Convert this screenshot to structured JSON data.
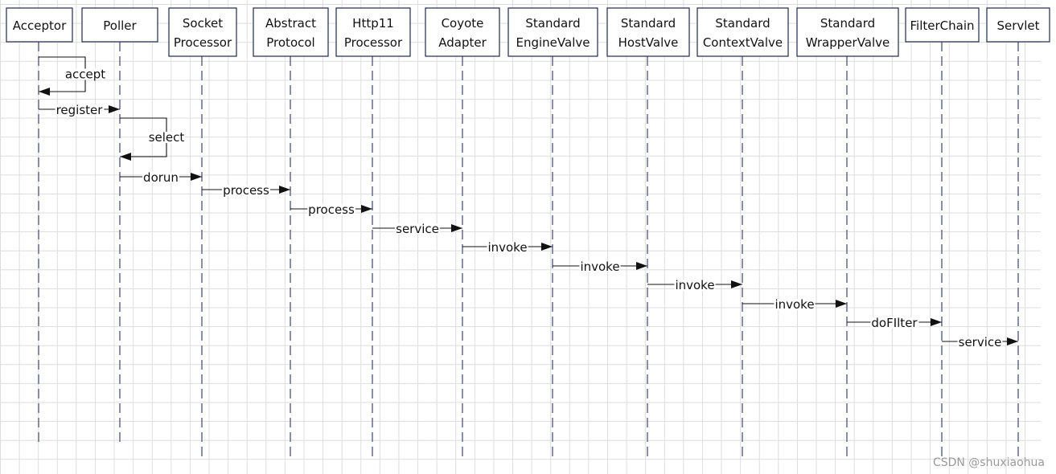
{
  "participants": [
    {
      "id": "acceptor",
      "lines": [
        "Acceptor"
      ]
    },
    {
      "id": "poller",
      "lines": [
        "Poller"
      ]
    },
    {
      "id": "socket-processor",
      "lines": [
        "Socket",
        "Processor"
      ]
    },
    {
      "id": "abstract-protocol",
      "lines": [
        "Abstract",
        "Protocol"
      ]
    },
    {
      "id": "http11-processor",
      "lines": [
        "Http11",
        "Processor"
      ]
    },
    {
      "id": "coyote-adapter",
      "lines": [
        "Coyote",
        "Adapter"
      ]
    },
    {
      "id": "standard-engine-valve",
      "lines": [
        "Standard",
        "EngineValve"
      ]
    },
    {
      "id": "standard-host-valve",
      "lines": [
        "Standard",
        "HostValve"
      ]
    },
    {
      "id": "standard-context-valve",
      "lines": [
        "Standard",
        "ContextValve"
      ]
    },
    {
      "id": "standard-wrapper-valve",
      "lines": [
        "Standard",
        "WrapperValve"
      ]
    },
    {
      "id": "filter-chain",
      "lines": [
        "FilterChain"
      ]
    },
    {
      "id": "servlet",
      "lines": [
        "Servlet"
      ]
    }
  ],
  "messages": [
    {
      "from": 0,
      "to": 0,
      "label": "accept"
    },
    {
      "from": 0,
      "to": 1,
      "label": "register"
    },
    {
      "from": 1,
      "to": 1,
      "label": "select"
    },
    {
      "from": 1,
      "to": 2,
      "label": "dorun"
    },
    {
      "from": 2,
      "to": 3,
      "label": "process"
    },
    {
      "from": 3,
      "to": 4,
      "label": "process"
    },
    {
      "from": 4,
      "to": 5,
      "label": "service"
    },
    {
      "from": 5,
      "to": 6,
      "label": "invoke"
    },
    {
      "from": 6,
      "to": 7,
      "label": "invoke"
    },
    {
      "from": 7,
      "to": 8,
      "label": "invoke"
    },
    {
      "from": 8,
      "to": 9,
      "label": "invoke"
    },
    {
      "from": 9,
      "to": 10,
      "label": "doFIlter"
    },
    {
      "from": 10,
      "to": 11,
      "label": "service"
    }
  ],
  "watermark": "CSDN @shuxiaohua"
}
